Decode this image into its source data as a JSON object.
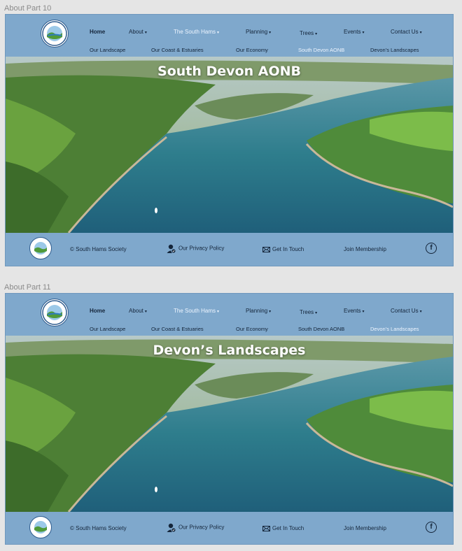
{
  "frames": [
    {
      "label": "About Part 10",
      "hero_title": "South Devon AONB",
      "active_sub": 3
    },
    {
      "label": "About Part 11",
      "hero_title": "Devon’s Landscapes",
      "active_sub": 4
    }
  ],
  "nav": {
    "items": [
      {
        "label": "Home"
      },
      {
        "label": "About"
      },
      {
        "label": "The South Hams"
      },
      {
        "label": "Planning"
      },
      {
        "label": "Trees"
      },
      {
        "label": "Events"
      },
      {
        "label": "Contact Us"
      }
    ],
    "sub_items": [
      {
        "label": "Our Landscape"
      },
      {
        "label": "Our Coast & Estuaries"
      },
      {
        "label": "Our Economy"
      },
      {
        "label": "South Devon AONB"
      },
      {
        "label": "Devon’s Landscapes"
      }
    ]
  },
  "footer": {
    "copyright": "© South Hams Society",
    "privacy": "Our Privacy Policy",
    "contact": "Get In Touch",
    "membership": "Join Membership",
    "facebook_glyph": "f"
  },
  "colors": {
    "frame_bg": "#7fa8cc",
    "active_text": "#eef5ff",
    "nav_text": "#14253a"
  }
}
